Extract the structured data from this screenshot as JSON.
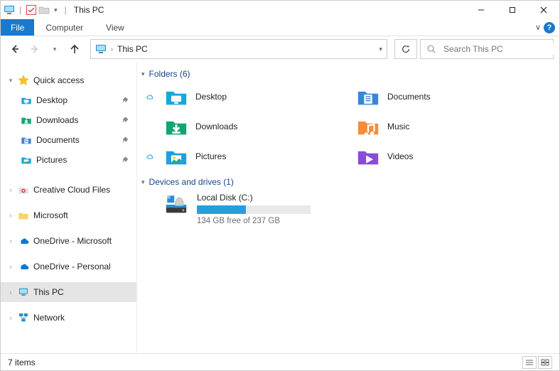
{
  "window": {
    "title": "This PC"
  },
  "ribbon": {
    "file": "File",
    "tabs": [
      "Computer",
      "View"
    ]
  },
  "nav": {
    "address": {
      "crumb": "This PC"
    },
    "search_placeholder": "Search This PC"
  },
  "sidebar": {
    "quick_access": {
      "label": "Quick access",
      "items": [
        {
          "label": "Desktop",
          "pinned": true,
          "icon": "desktop"
        },
        {
          "label": "Downloads",
          "pinned": true,
          "icon": "downloads"
        },
        {
          "label": "Documents",
          "pinned": true,
          "icon": "documents"
        },
        {
          "label": "Pictures",
          "pinned": true,
          "icon": "pictures"
        }
      ]
    },
    "roots": [
      {
        "label": "Creative Cloud Files",
        "icon": "cc"
      },
      {
        "label": "Microsoft",
        "icon": "folder"
      },
      {
        "label": "OneDrive - Microsoft",
        "icon": "onedrive"
      },
      {
        "label": "OneDrive - Personal",
        "icon": "onedrive"
      },
      {
        "label": "This PC",
        "icon": "pc",
        "selected": true
      },
      {
        "label": "Network",
        "icon": "network"
      }
    ]
  },
  "content": {
    "folders_header": "Folders (6)",
    "folders": [
      {
        "label": "Desktop",
        "icon": "desktop",
        "cloud": true
      },
      {
        "label": "Documents",
        "icon": "documents",
        "cloud": false
      },
      {
        "label": "Downloads",
        "icon": "downloads",
        "cloud": false
      },
      {
        "label": "Music",
        "icon": "music",
        "cloud": false
      },
      {
        "label": "Pictures",
        "icon": "pictures",
        "cloud": true
      },
      {
        "label": "Videos",
        "icon": "videos",
        "cloud": false
      }
    ],
    "drives_header": "Devices and drives (1)",
    "drives": [
      {
        "label": "Local Disk (C:)",
        "free_text": "134 GB free of 237 GB",
        "used_pct": 43
      }
    ]
  },
  "status": {
    "items_text": "7 items"
  }
}
